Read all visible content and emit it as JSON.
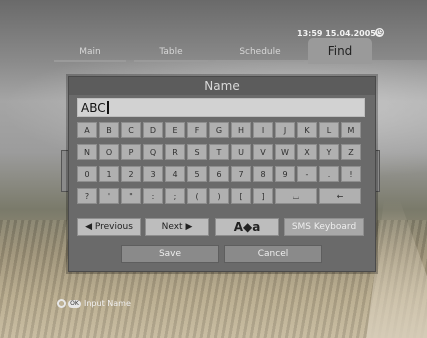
{
  "status": {
    "time": "13:59",
    "date": "15.04.2005",
    "clock_icon": "clock-icon"
  },
  "tabs": [
    {
      "label": "Main",
      "active": false
    },
    {
      "label": "Table",
      "active": false
    },
    {
      "label": "Schedule",
      "active": false
    },
    {
      "label": "Find",
      "active": true
    }
  ],
  "dialog": {
    "title": "Name",
    "input_value": "ABC",
    "keys": [
      [
        "A",
        "B",
        "C",
        "D",
        "E",
        "F",
        "G",
        "H",
        "I",
        "J",
        "K",
        "L",
        "M"
      ],
      [
        "N",
        "O",
        "P",
        "Q",
        "R",
        "S",
        "T",
        "U",
        "V",
        "W",
        "X",
        "Y",
        "Z"
      ],
      [
        "0",
        "1",
        "2",
        "3",
        "4",
        "5",
        "6",
        "7",
        "8",
        "9",
        "-",
        ".",
        "!"
      ],
      [
        "?",
        "'",
        "\"",
        ":",
        ";",
        "(",
        ")",
        "[",
        "]",
        "space",
        "backspace"
      ]
    ],
    "buttons": {
      "previous": "Previous",
      "next": "Next",
      "case_toggle": "A◆a",
      "sms_keyboard": "SMS Keyboard",
      "save": "Save",
      "cancel": "Cancel"
    }
  },
  "help": {
    "ok_label": "OK",
    "text": "Input Name"
  },
  "colors": {
    "dialog_bg": "#6a6a6a",
    "key_bg": "#b0b0b0",
    "active_tab": "#9a9a9a"
  }
}
